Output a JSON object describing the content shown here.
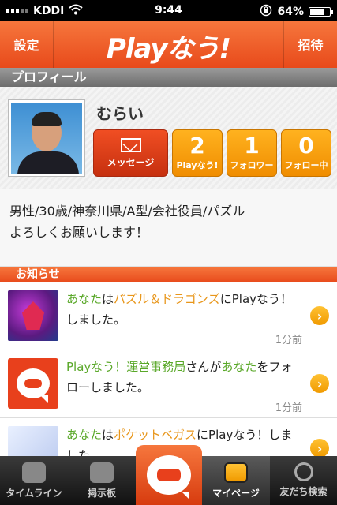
{
  "status": {
    "carrier": "KDDI",
    "time": "9:44",
    "battery": "64%",
    "battery_level": 0.64
  },
  "nav": {
    "left": "設定",
    "title": "Playなう!",
    "right": "招待"
  },
  "profile": {
    "header": "プロフィール",
    "name": "むらい",
    "message_label": "メッセージ",
    "stats": [
      {
        "num": "2",
        "label": "Playなう!"
      },
      {
        "num": "1",
        "label": "フォロワー"
      },
      {
        "num": "0",
        "label": "フォロー中"
      }
    ],
    "bio_line1": "男性/30歳/神奈川県/A型/会社役員/パズル",
    "bio_line2": "よろしくお願いします！"
  },
  "news": {
    "header": "お知らせ",
    "items": [
      {
        "p1": "あなた",
        "p2": "は",
        "p3": "パズル＆ドラゴンズ",
        "p4": "にPlayなう！しました。",
        "time": "1分前"
      },
      {
        "p1": "Playなう！運営事務局",
        "p2": "さんが",
        "p3": "あなた",
        "p4": "をフォローしました。",
        "time": "1分前"
      },
      {
        "p1": "あなた",
        "p2": "は",
        "p3": "ポケットベガス",
        "p4": "にPlayなう！しました。"
      }
    ]
  },
  "tabs": [
    {
      "label": "タイムライン"
    },
    {
      "label": "掲示板"
    },
    {
      "label": "マイページ"
    },
    {
      "label": "友だち検索"
    }
  ]
}
